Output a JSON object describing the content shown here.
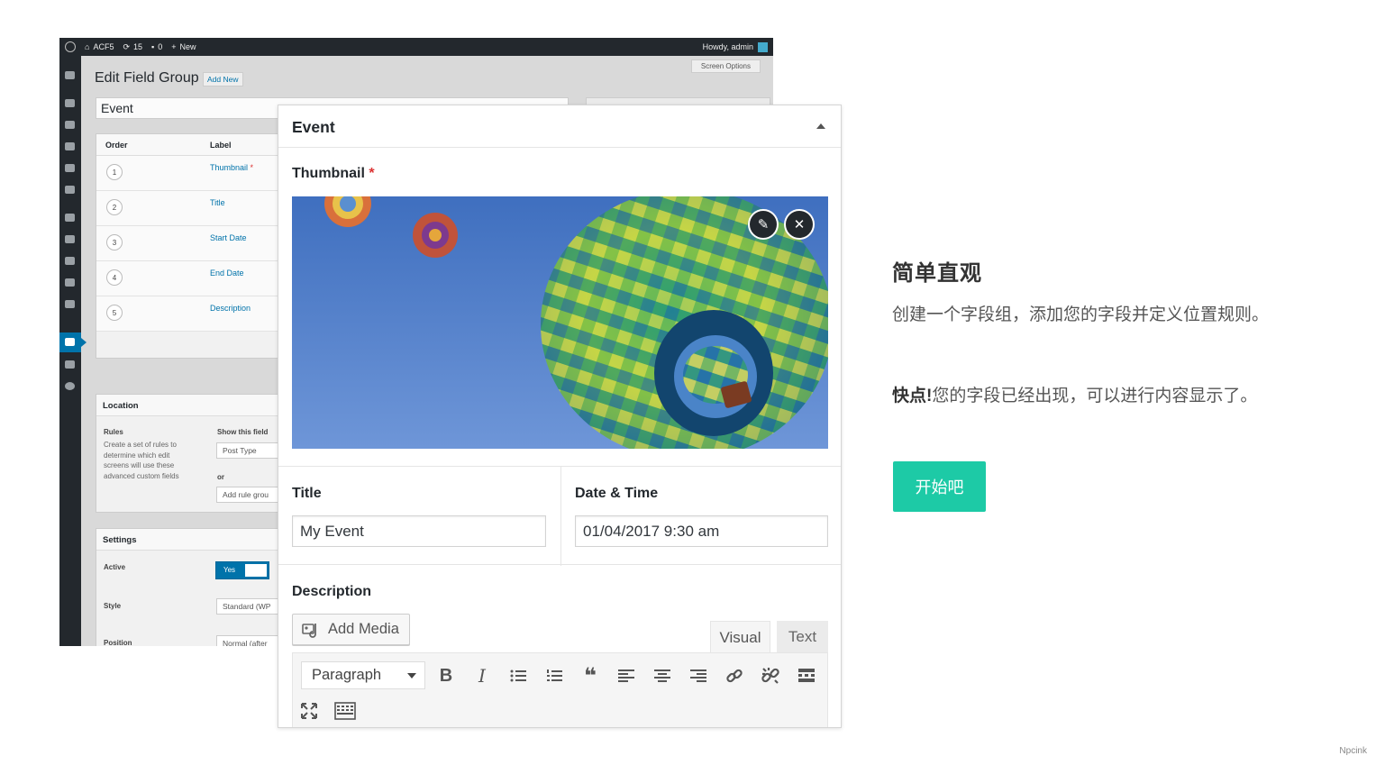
{
  "admin_bar": {
    "site": "ACF5",
    "updates": "15",
    "comments": "0",
    "new_label": "New",
    "howdy": "Howdy, admin"
  },
  "edit_screen": {
    "page_title": "Edit Field Group",
    "add_new_label": "Add New",
    "screen_options_label": "Screen Options",
    "group_title_value": "Event",
    "fields_header": {
      "order": "Order",
      "label": "Label"
    },
    "fields": [
      {
        "order": "1",
        "label": "Thumbnail",
        "required_mark": "*"
      },
      {
        "order": "2",
        "label": "Title"
      },
      {
        "order": "3",
        "label": "Start Date"
      },
      {
        "order": "4",
        "label": "End Date"
      },
      {
        "order": "5",
        "label": "Description"
      }
    ],
    "location": {
      "title": "Location",
      "rules_label": "Rules",
      "rules_help": "Create a set of rules to determine which edit screens will use these advanced custom fields",
      "show_if_label": "Show this field",
      "post_type_value": "Post Type",
      "or_label": "or",
      "add_rule_group_label": "Add rule grou"
    },
    "settings": {
      "title": "Settings",
      "active_label": "Active",
      "active_toggle": "Yes",
      "style_label": "Style",
      "style_value": "Standard (WP",
      "position_label": "Position",
      "position_value": "Normal (after"
    }
  },
  "event_card": {
    "title": "Event",
    "thumbnail_label": "Thumbnail",
    "required_mark": "*",
    "edit_icon_glyph": "✎",
    "remove_icon_glyph": "✕",
    "title_label": "Title",
    "title_value": "My Event",
    "datetime_label": "Date & Time",
    "datetime_value": "01/04/2017 9:30 am",
    "description_label": "Description",
    "add_media_label": "Add Media",
    "tab_visual": "Visual",
    "tab_text": "Text",
    "format_select_value": "Paragraph",
    "toolbar_icons": [
      "bold-icon",
      "italic-icon",
      "bullet-list-icon",
      "numbered-list-icon",
      "blockquote-icon",
      "align-left-icon",
      "align-center-icon",
      "align-right-icon",
      "link-icon",
      "unlink-icon",
      "read-more-icon",
      "fullscreen-icon",
      "toolbar-toggle-icon"
    ],
    "toolbar_glyphs": {
      "bold": "B",
      "italic": "I",
      "blockquote": "❝"
    }
  },
  "promo": {
    "heading": "简单直观",
    "paragraph_1": "创建一个字段组，添加您的字段并定义位置规则。",
    "paragraph_2_lead": "快点!",
    "paragraph_2_body": "您的字段已经出现，可以进行内容显示了。",
    "cta_label": "开始吧"
  },
  "watermark": "Npcink",
  "colors": {
    "accent_cta": "#1dcaa6",
    "wp_blue": "#0073aa",
    "admin_dark": "#23282d",
    "required_red": "#dc3232"
  }
}
